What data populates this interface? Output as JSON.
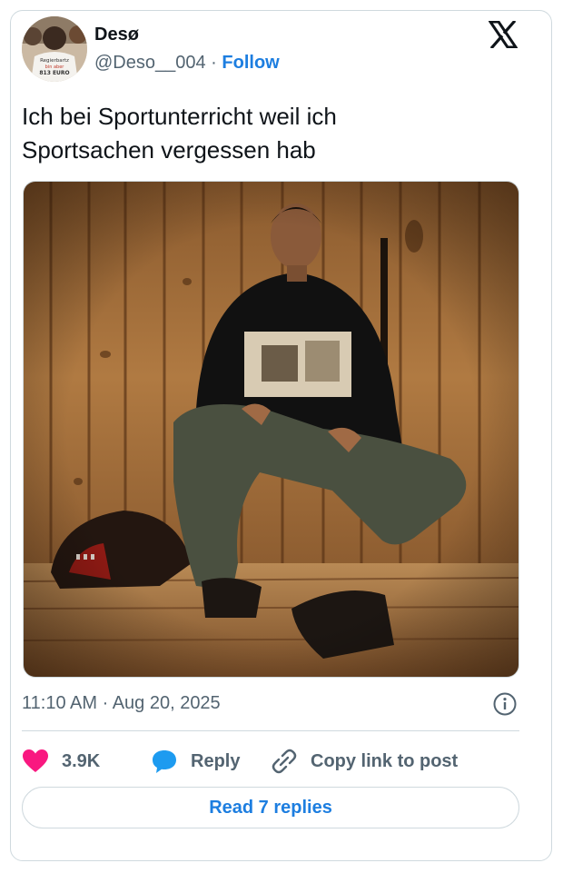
{
  "author": {
    "name": "Desø",
    "handle": "@Deso__004",
    "separator": "·",
    "follow_label": "Follow",
    "avatar_shirt_text": [
      "Regierbartz",
      "bin aber",
      "813 EURO"
    ]
  },
  "platform": {
    "logo_icon": "x-logo-icon"
  },
  "tweet": {
    "text_line1": "Ich bei Sportunterricht weil ich",
    "text_line2": "Sportsachen vergessen hab",
    "timestamp": "11:10 AM · Aug 20, 2025"
  },
  "actions": {
    "like_count": "3.9K",
    "reply_label": "Reply",
    "copy_label": "Copy link to post",
    "like_icon": "heart-icon",
    "reply_icon": "speech-bubble-icon",
    "copy_icon": "link-icon",
    "info_icon": "info-icon"
  },
  "read_replies_label": "Read 7 replies",
  "colors": {
    "like": "#f91880",
    "reply": "#1d9bf0",
    "link": "#1d7ee0",
    "muted": "#536471",
    "border": "#cfd9de"
  }
}
